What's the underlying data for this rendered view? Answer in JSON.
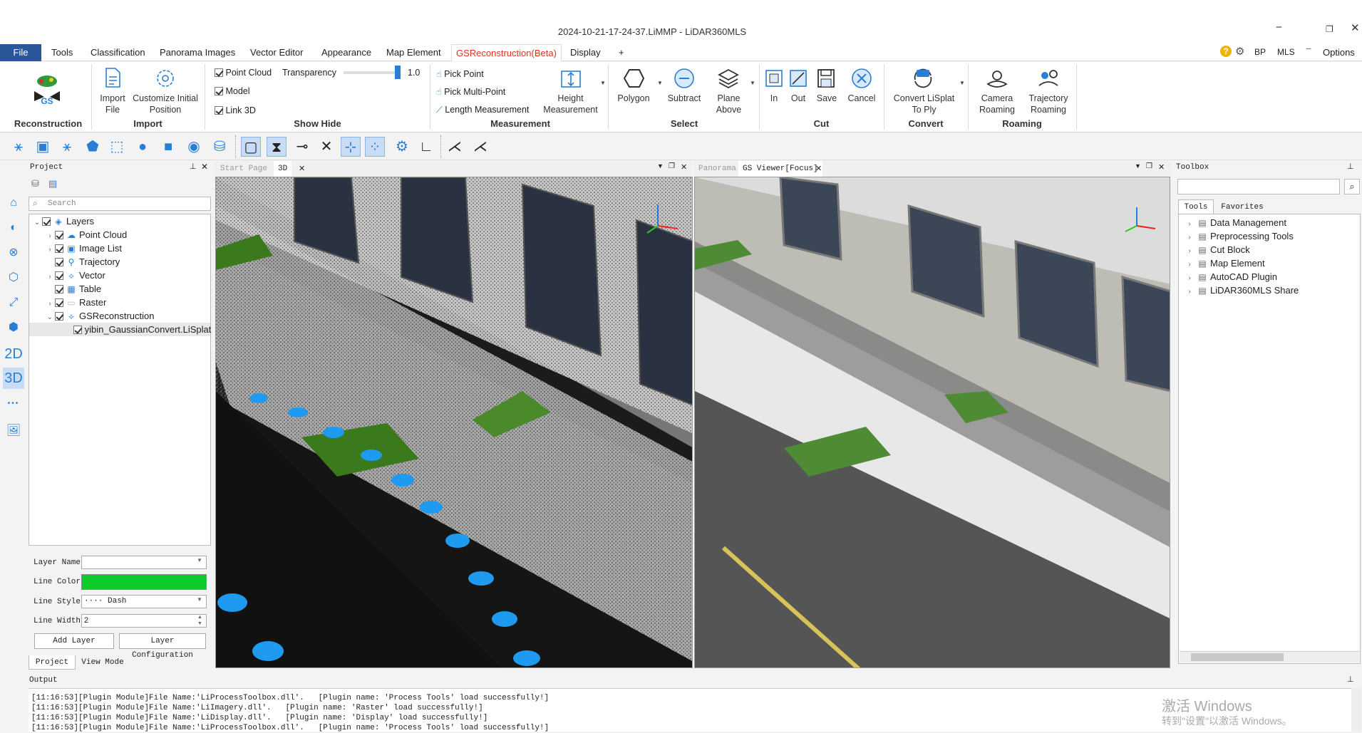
{
  "window": {
    "title": "2024-10-21-17-24-37.LiMMP - LiDAR360MLS",
    "minimize": "−",
    "restore": "❐",
    "close": "✕"
  },
  "menu": [
    "File",
    "Tools",
    "Classification",
    "Panorama Images",
    "Vector Editor",
    "Appearance",
    "Map Element",
    "GSReconstruction(Beta)",
    "Display",
    "+"
  ],
  "menu_right": {
    "help": "?",
    "settings": "⚙",
    "bp": "BP",
    "mls": "MLS",
    "minimize": "−",
    "options": "Options"
  },
  "ribbon": {
    "reconstruction": {
      "group": "Reconstruction",
      "badge": "GS"
    },
    "import": {
      "group": "Import",
      "import_file": [
        "Import",
        "File"
      ],
      "customize": [
        "Customize Initial",
        "Position"
      ]
    },
    "show_hide": {
      "group": "Show Hide",
      "point_cloud": "Point Cloud",
      "transparency": "Transparency",
      "transparency_value": "1.0",
      "transparency_level": 1.0,
      "model": "Model",
      "link3d": "Link 3D"
    },
    "measurement": {
      "group": "Measurement",
      "pick_point": "Pick Point",
      "pick_multi": "Pick Multi-Point",
      "length": "Length Measurement",
      "height": [
        "Height",
        "Measurement"
      ]
    },
    "select": {
      "group": "Select",
      "polygon": "Polygon",
      "subtract": "Subtract",
      "plane_above": [
        "Plane",
        "Above"
      ]
    },
    "cut": {
      "group": "Cut",
      "in": "In",
      "out": "Out",
      "save": "Save",
      "cancel": "Cancel"
    },
    "convert": {
      "group": "Convert",
      "convert": [
        "Convert LiSplat",
        "To Ply"
      ]
    },
    "roaming": {
      "group": "Roaming",
      "camera": [
        "Camera",
        "Roaming"
      ],
      "trajectory": [
        "Trajectory",
        "Roaming"
      ]
    }
  },
  "leftstrip": {
    "twod": "2D",
    "threed": "3D",
    "more": "•••"
  },
  "project": {
    "title": "Project",
    "pin": "📌",
    "close": "✕",
    "search_placeholder": "Search",
    "tree": [
      {
        "label": "Layers",
        "level": 0,
        "expanded": true
      },
      {
        "label": "Point Cloud",
        "level": 1
      },
      {
        "label": "Image List",
        "level": 1
      },
      {
        "label": "Trajectory",
        "level": 1
      },
      {
        "label": "Vector",
        "level": 1
      },
      {
        "label": "Table",
        "level": 1
      },
      {
        "label": "Raster",
        "level": 1
      },
      {
        "label": "GSReconstruction",
        "level": 1,
        "expanded": true
      },
      {
        "label": "yibin_GaussianConvert.LiSplat",
        "level": 2,
        "selected": true
      }
    ],
    "props": {
      "layer_name_label": "Layer Name",
      "layer_name_value": "",
      "line_color_label": "Line Color",
      "line_color": "#0ccc2c",
      "line_style_label": "Line Style",
      "line_style_value": "···· Dash",
      "line_width_label": "Line Width",
      "line_width_value": "2"
    },
    "add_layer": "Add Layer",
    "layer_config": "Layer Configuration",
    "tabs": [
      "Project",
      "View Mode"
    ]
  },
  "view3d": {
    "tabs": [
      "Start Page",
      "3D"
    ],
    "close": "✕"
  },
  "viewgs": {
    "tabs": [
      "Panorama",
      "GS Viewer[Focus]"
    ],
    "close": "✕"
  },
  "toolbox": {
    "title": "Toolbox",
    "tabs": [
      "Tools",
      "Favorites"
    ],
    "items": [
      "Data Management",
      "Preprocessing Tools",
      "Cut Block",
      "Map Element",
      "AutoCAD Plugin",
      "LiDAR360MLS Share"
    ]
  },
  "output": {
    "title": "Output",
    "lines": [
      "[11:16:53][Plugin Module]File Name:'LiProcessToolbox.dll'.   [Plugin name: 'Process Tools' load successfully!]",
      "[11:16:53][Plugin Module]File Name:'LiImagery.dll'.   [Plugin name: 'Raster' load successfully!]",
      "[11:16:53][Plugin Module]File Name:'LiDisplay.dll'.   [Plugin name: 'Display' load successfully!]",
      "[11:16:53][Plugin Module]File Name:'LiProcessToolbox.dll'.   [Plugin name: 'Process Tools' load successfully!]"
    ]
  },
  "watermark": {
    "line1": "激活 Windows",
    "line2": "转到\"设置\"以激活 Windows。"
  }
}
